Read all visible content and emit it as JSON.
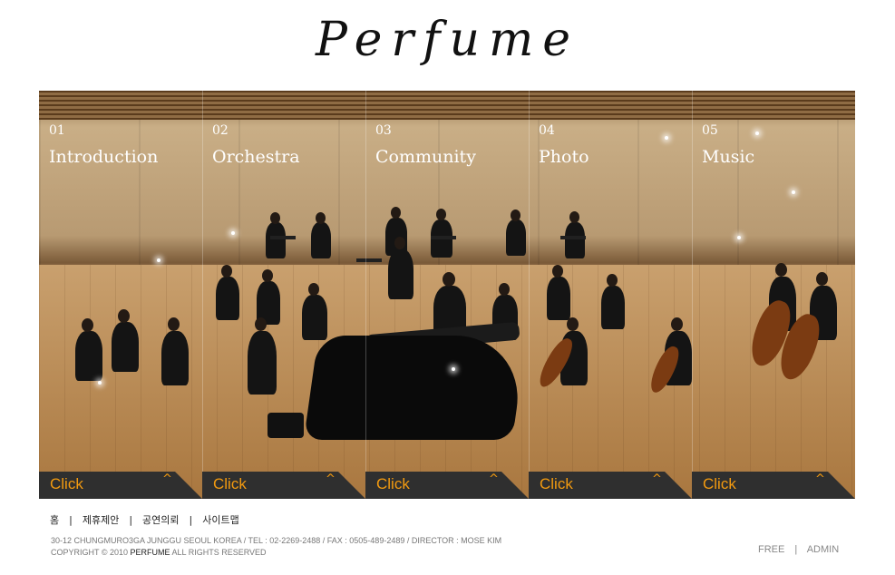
{
  "brand": {
    "logo": "Perfume"
  },
  "panels": [
    {
      "num": "01",
      "title": "Introduction",
      "click": "Click",
      "caret": "^"
    },
    {
      "num": "02",
      "title": "Orchestra",
      "click": "Click",
      "caret": "^"
    },
    {
      "num": "03",
      "title": "Community",
      "click": "Click",
      "caret": "^"
    },
    {
      "num": "04",
      "title": "Photo",
      "click": "Click",
      "caret": "^"
    },
    {
      "num": "05",
      "title": "Music",
      "click": "Click",
      "caret": "^"
    }
  ],
  "footer": {
    "links": [
      "홈",
      "제휴제안",
      "공연의뢰",
      "사이트맵"
    ],
    "separator": "|",
    "address": "30-12 CHUNGMURO3GA JUNGGU SEOUL KOREA / TEL : 02-2269-2488 / FAX : 0505-489-2489 /  DIRECTOR : MOSE KIM",
    "copyright_prefix": "COPYRIGHT © 2010 ",
    "copyright_brand": "PERFUME",
    "copyright_suffix": " ALL RIGHTS RESERVED",
    "admin": {
      "free": "FREE",
      "sep": "|",
      "admin": "ADMIN"
    }
  },
  "colors": {
    "accent": "#f29a10",
    "tab_bg": "#2f2f2f"
  }
}
